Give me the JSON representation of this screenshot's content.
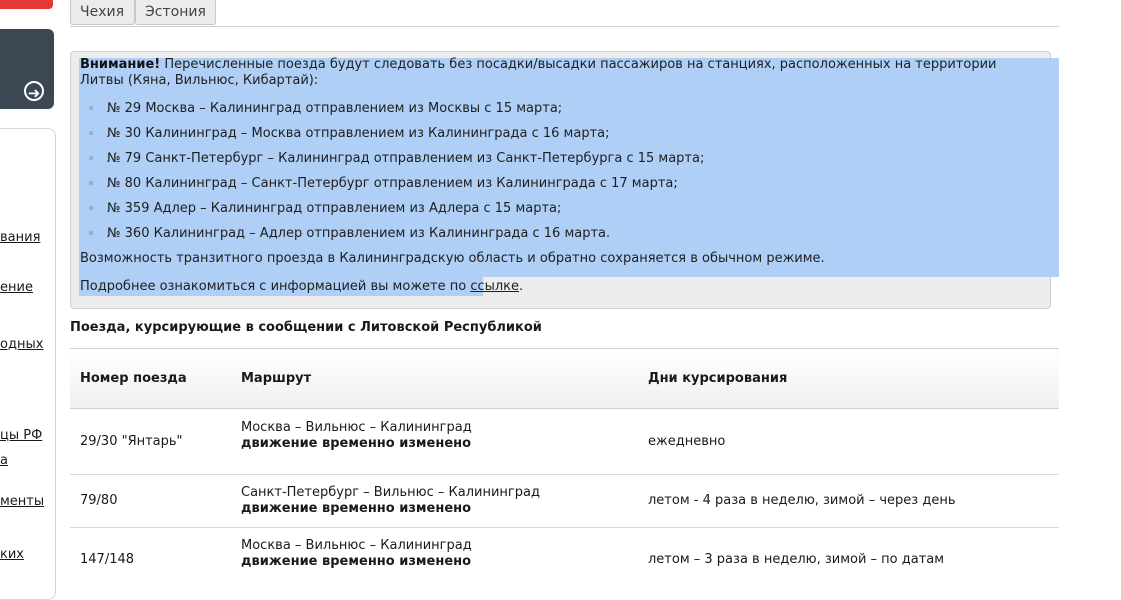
{
  "tabs": [
    "Чехия",
    "Эстония"
  ],
  "sidebar": {
    "links": [
      "вания",
      "ение",
      "одных",
      "цы РФ",
      "а",
      "менты",
      "ких"
    ]
  },
  "notice": {
    "title": "Внимание!",
    "intro": " Перечисленные поезда будут следовать без посадки/высадки пассажиров на станциях, расположенных на территории Литвы (Кяна, Вильнюс, Кибартай):",
    "items": [
      "№ 29 Москва – Калининград отправлением из Москвы с 15 марта;",
      "№ 30 Калининград – Москва отправлением из Калининграда с 16 марта;",
      "№ 79 Санкт-Петербург – Калининград отправлением из Санкт-Петербурга с 15 марта;",
      "№ 80 Калининград – Санкт-Петербург отправлением из Калининграда с 17 марта;",
      "№ 359 Адлер – Калининград отправлением из Адлера с 15 марта;",
      "№ 360 Калининград – Адлер отправлением из Калининграда с 16 марта."
    ],
    "transit_note": "Возможность транзитного проезда в Калининградскую область и обратно сохраняется в обычном режиме.",
    "more_text": "Подробнее ознакомиться с информацией вы можете по ",
    "more_link": "ссылке",
    "more_end": "."
  },
  "section_title": "Поезда, курсирующие в сообщении с Литовской Республикой",
  "table": {
    "headers": [
      "Номер поезда",
      "Маршрут",
      "Дни курсирования"
    ],
    "rows": [
      {
        "number": "29/30 \"Янтарь\"",
        "route": "Москва – Вильнюс – Калининград",
        "status": "движение временно изменено",
        "days": "ежедневно"
      },
      {
        "number": "79/80",
        "route": "Санкт-Петербург – Вильнюс – Калининград",
        "status": "движение временно изменено",
        "days": "летом - 4 раза в неделю, зимой – через день"
      },
      {
        "number": "147/148",
        "route": "Москва – Вильнюс – Калининград",
        "status": "движение временно изменено",
        "days": "летом – 3 раза в неделю, зимой – по датам"
      }
    ]
  }
}
